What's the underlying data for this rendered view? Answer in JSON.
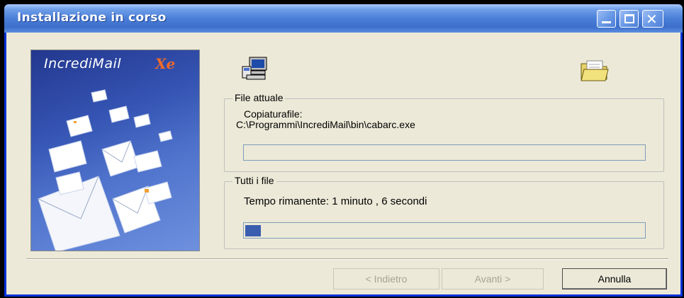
{
  "window": {
    "title": "Installazione in corso"
  },
  "banner": {
    "logo_text": "IncrediMail",
    "logo_suffix": "Xe"
  },
  "icons": {
    "left": "computer-install-icon",
    "right": "open-folder-icon"
  },
  "current_file": {
    "legend": "File attuale",
    "line1": "Copiaturafile:",
    "line2": "C:\\Programmi\\IncrediMail\\bin\\cabarc.exe",
    "progress": 0
  },
  "all_files": {
    "legend": "Tutti i file",
    "status": "Tempo rimanente: 1 minuto , 6 secondi",
    "progress": 0.04
  },
  "buttons": {
    "back": "< Indietro",
    "next": "Avanti >",
    "cancel": "Annulla"
  },
  "colors": {
    "titlebar": "#3d6fcc",
    "progress_fill": "#3a5eaf",
    "window_bg": "#ece9d8"
  }
}
